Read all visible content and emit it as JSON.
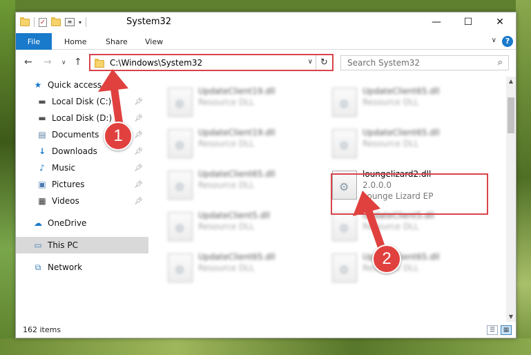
{
  "window": {
    "title": "System32",
    "minimize_glyph": "—",
    "maximize_glyph": "☐",
    "close_glyph": "✕"
  },
  "ribbon": {
    "tabs": [
      "File",
      "Home",
      "Share",
      "View"
    ],
    "help_label": "?"
  },
  "address_bar": {
    "path": "C:\\Windows\\System32",
    "refresh_glyph": "↻"
  },
  "search": {
    "placeholder": "Search System32"
  },
  "nav_pane": {
    "items": [
      {
        "label": "Quick access",
        "icon": "star-icon"
      },
      {
        "label": "Local Disk (C:)",
        "icon": "drive-icon",
        "pinned": true
      },
      {
        "label": "Local Disk (D:)",
        "icon": "drive-icon",
        "pinned": true
      },
      {
        "label": "Documents",
        "icon": "documents-icon",
        "pinned": true
      },
      {
        "label": "Downloads",
        "icon": "downloads-icon",
        "pinned": true
      },
      {
        "label": "Music",
        "icon": "music-icon",
        "pinned": true
      },
      {
        "label": "Pictures",
        "icon": "pictures-icon",
        "pinned": true
      },
      {
        "label": "Videos",
        "icon": "videos-icon",
        "pinned": true
      },
      {
        "label": "OneDrive",
        "icon": "cloud-icon"
      },
      {
        "label": "This PC",
        "icon": "computer-icon",
        "selected": true
      },
      {
        "label": "Network",
        "icon": "network-icon"
      }
    ]
  },
  "files": [
    {
      "name": "UpdateClient19.dll",
      "desc": "Resource DLL",
      "company": ""
    },
    {
      "name": "UpdateClient65.dll",
      "desc": "Resource DLL",
      "company": ""
    },
    {
      "name": "UpdateClient19.dll",
      "desc": "Resource DLL",
      "company": ""
    },
    {
      "name": "UpdateClient65.dll",
      "desc": "Resource DLL",
      "company": ""
    },
    {
      "name": "UpdateClient65.dll",
      "desc": "Resource DLL",
      "company": ""
    },
    {
      "name": "loungelizard2.dll",
      "desc": "2.0.0.0",
      "company": "Lounge Lizard EP"
    },
    {
      "name": "UpdateClient5.dll",
      "desc": "Resource DLL",
      "company": ""
    },
    {
      "name": "UpdateClient5.dll",
      "desc": "Resource DLL",
      "company": ""
    },
    {
      "name": "UpdateClient65.dll",
      "desc": "Resource DLL",
      "company": ""
    },
    {
      "name": "UpdateClient65.dll",
      "desc": "Resource DLL",
      "company": ""
    }
  ],
  "status_bar": {
    "item_count": "162 items"
  },
  "annotations": {
    "badge_1": "1",
    "badge_2": "2",
    "color": "#e0413f"
  },
  "colors": {
    "accent": "#1979ca",
    "highlight": "#d9434a"
  }
}
